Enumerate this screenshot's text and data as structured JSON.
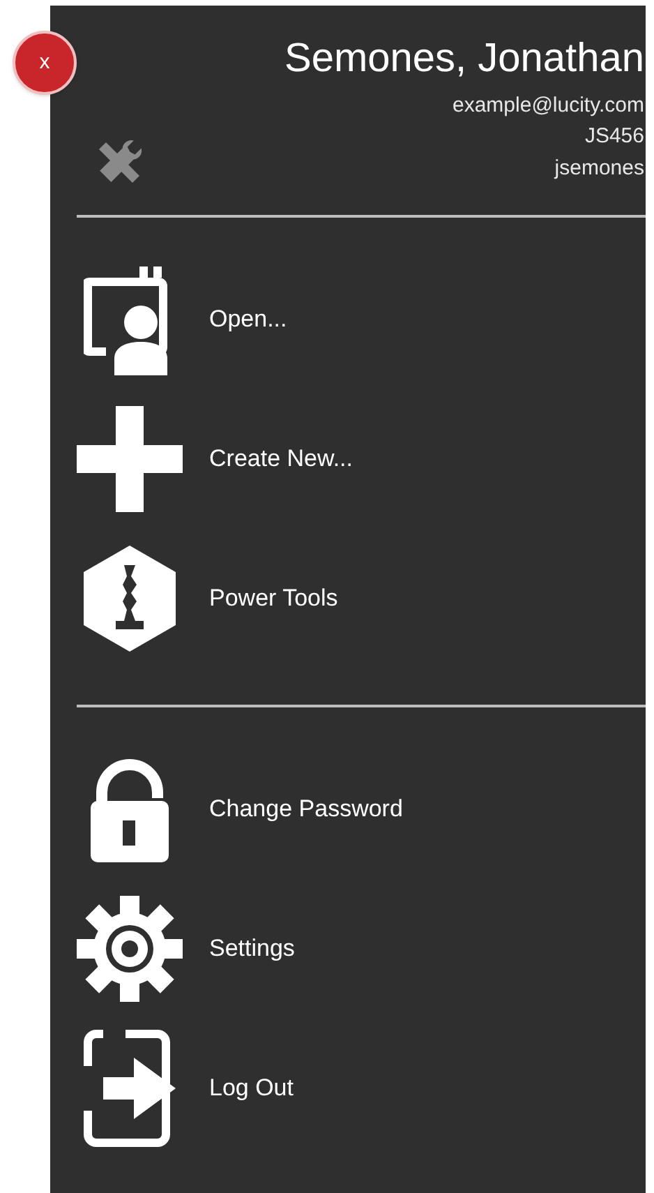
{
  "close_button": {
    "label": "x"
  },
  "user": {
    "name": "Semones, Jonathan",
    "email": "example@lucity.com",
    "code": "JS456",
    "username": "jsemones"
  },
  "menu_sections": [
    {
      "items": [
        {
          "label": "Open...",
          "kind": "open"
        },
        {
          "label": "Create New...",
          "kind": "create"
        },
        {
          "label": "Power Tools",
          "kind": "tools"
        }
      ]
    },
    {
      "items": [
        {
          "label": "Change Password",
          "kind": "lock"
        },
        {
          "label": "Settings",
          "kind": "gear"
        },
        {
          "label": "Log Out",
          "kind": "logout"
        }
      ]
    }
  ]
}
